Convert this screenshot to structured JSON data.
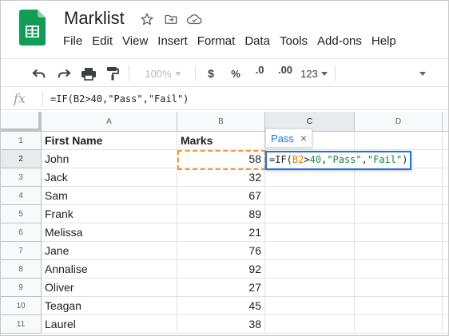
{
  "app": {
    "doc_title": "Marklist",
    "brand_color": "#0f9d58",
    "title_icons": [
      "star-icon",
      "move-to-folder-icon",
      "cloud-status-icon"
    ]
  },
  "menu": [
    "File",
    "Edit",
    "View",
    "Insert",
    "Format",
    "Data",
    "Tools",
    "Add-ons",
    "Help"
  ],
  "toolbar": {
    "zoom": "100%",
    "currency": "$",
    "percent": "%",
    "decrease_decimals": ".0",
    "increase_decimals": ".00",
    "more_formats": "123",
    "icons": [
      "undo-icon",
      "redo-icon",
      "print-icon",
      "paint-format-icon",
      "collapse-toolbar-icon"
    ]
  },
  "formula_bar": {
    "fx": "fx",
    "formula": "=IF(B2>40,\"Pass\",\"Fail\")"
  },
  "grid": {
    "columns": [
      "A",
      "B",
      "C",
      "D"
    ],
    "active_column": "C",
    "rows": [
      {
        "num": "1",
        "name": "First Name",
        "marks": "Marks"
      },
      {
        "num": "2",
        "name": "John",
        "marks": "58"
      },
      {
        "num": "3",
        "name": "Jack",
        "marks": "32"
      },
      {
        "num": "4",
        "name": "Sam",
        "marks": "67"
      },
      {
        "num": "5",
        "name": "Frank",
        "marks": "89"
      },
      {
        "num": "6",
        "name": "Melissa",
        "marks": "21"
      },
      {
        "num": "7",
        "name": "Jane",
        "marks": "76"
      },
      {
        "num": "8",
        "name": "Annalise",
        "marks": "92"
      },
      {
        "num": "9",
        "name": "Oliver",
        "marks": "27"
      },
      {
        "num": "10",
        "name": "Teagan",
        "marks": "45"
      },
      {
        "num": "11",
        "name": "Laurel",
        "marks": "38"
      }
    ],
    "active_row": "2"
  },
  "editor": {
    "prefix": "=IF(",
    "ref": "B2",
    "op": ">",
    "num": "40",
    "sep1": ",",
    "str1": "\"Pass\"",
    "sep2": ",",
    "str2": "\"Fail\"",
    "suffix": ")"
  },
  "preview": {
    "value": "Pass",
    "close": "×"
  }
}
